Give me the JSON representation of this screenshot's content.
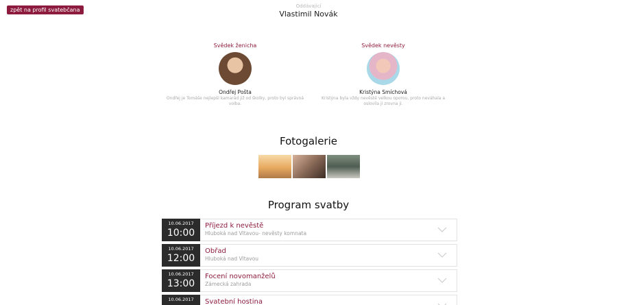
{
  "back_button": {
    "label": "zpět na profil svatebčana"
  },
  "officiant": {
    "label": "Oddávající",
    "name": "Vlastimil Novák"
  },
  "witnesses": [
    {
      "role": "Svědek ženicha",
      "name": "Ondřej Pošta",
      "bio": "Ondřej je Tomáše nejlepší kamarád již od školky, proto byl správná volba."
    },
    {
      "role": "Svědek nevěsty",
      "name": "Kristýna Smíchová",
      "bio": "Kristýna byla vždy nevěstě velkou oporou, proto neváhala a oslovila ji zrovna ji."
    }
  ],
  "gallery": {
    "title": "Fotogalerie"
  },
  "program": {
    "title": "Program svatby",
    "events": [
      {
        "date": "10.06.2017",
        "time": "10:00",
        "title": "Příjezd k nevěstě",
        "place": "Hluboká nad Vltavou- nevěsty komnata"
      },
      {
        "date": "10.06.2017",
        "time": "12:00",
        "title": "Obřad",
        "place": "Hluboká nad Vltavou"
      },
      {
        "date": "10.06.2017",
        "time": "13:00",
        "title": "Focení novomanželů",
        "place": "Zámecká zahrada"
      },
      {
        "date": "10.06.2017",
        "time": "",
        "title": "Svatební hostina",
        "place": ""
      }
    ]
  },
  "colors": {
    "accent": "#8d1b3d",
    "time_block": "#2b2b2b"
  }
}
